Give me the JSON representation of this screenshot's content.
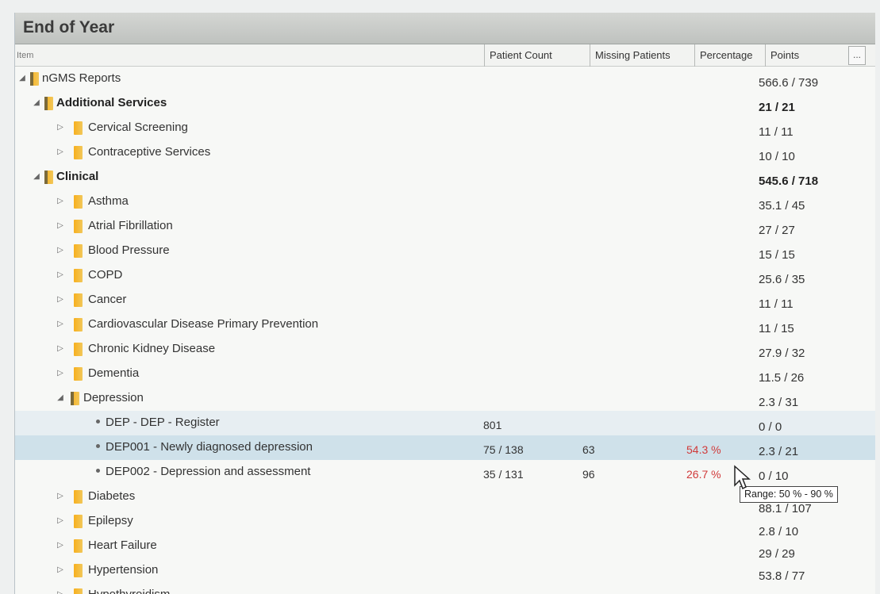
{
  "window": {
    "title": "End of Year"
  },
  "columns": {
    "item": "Item",
    "patient_count": "Patient Count",
    "missing_patients": "Missing Patients",
    "percentage": "Percentage",
    "points": "Points",
    "more": "..."
  },
  "rows": [
    {
      "label": "nGMS Reports",
      "points": "566.6 / 739"
    },
    {
      "label": "Additional Services",
      "points": "21 / 21"
    },
    {
      "label": "Cervical Screening",
      "points": "11 / 11"
    },
    {
      "label": "Contraceptive Services",
      "points": "10 / 10"
    },
    {
      "label": "Clinical",
      "points": "545.6 / 718"
    },
    {
      "label": "Asthma",
      "points": "35.1 / 45"
    },
    {
      "label": "Atrial Fibrillation",
      "points": "27 / 27"
    },
    {
      "label": "Blood Pressure",
      "points": "15 / 15"
    },
    {
      "label": "COPD",
      "points": "25.6 / 35"
    },
    {
      "label": "Cancer",
      "points": "11 / 11"
    },
    {
      "label": "Cardiovascular Disease Primary Prevention",
      "points": "11 / 15"
    },
    {
      "label": "Chronic Kidney Disease",
      "points": "27.9 / 32"
    },
    {
      "label": "Dementia",
      "points": "11.5 / 26"
    },
    {
      "label": "Depression",
      "points": "2.3 / 31"
    },
    {
      "label": "DEP - DEP - Register",
      "patient_count": "801",
      "points": "0 / 0"
    },
    {
      "label": "DEP001 - Newly diagnosed depression",
      "patient_count": "75 / 138",
      "missing": "63",
      "percentage": "54.3 %",
      "points": "2.3 / 21"
    },
    {
      "label": "DEP002 - Depression and assessment",
      "patient_count": "35 / 131",
      "missing": "96",
      "percentage": "26.7 %",
      "points": "0 / 10"
    },
    {
      "label": "Diabetes",
      "points": "88.1 / 107"
    },
    {
      "label": "Epilepsy",
      "points": "2.8 / 10"
    },
    {
      "label": "Heart Failure",
      "points": "29 / 29"
    },
    {
      "label": "Hypertension",
      "points": "53.8 / 77"
    },
    {
      "label": "Hypothyroidism",
      "points": ""
    }
  ],
  "tooltip": {
    "text": "Range: 50 % - 90 %"
  },
  "colors": {
    "percentage_text": "#d03a3a",
    "selected_row": "#cfe1ea",
    "folder": "#f7b01e"
  },
  "icons": {
    "expanded": "triangle-down-icon",
    "collapsed": "triangle-right-icon",
    "folder": "folder-icon",
    "leaf": "bullet-icon"
  }
}
